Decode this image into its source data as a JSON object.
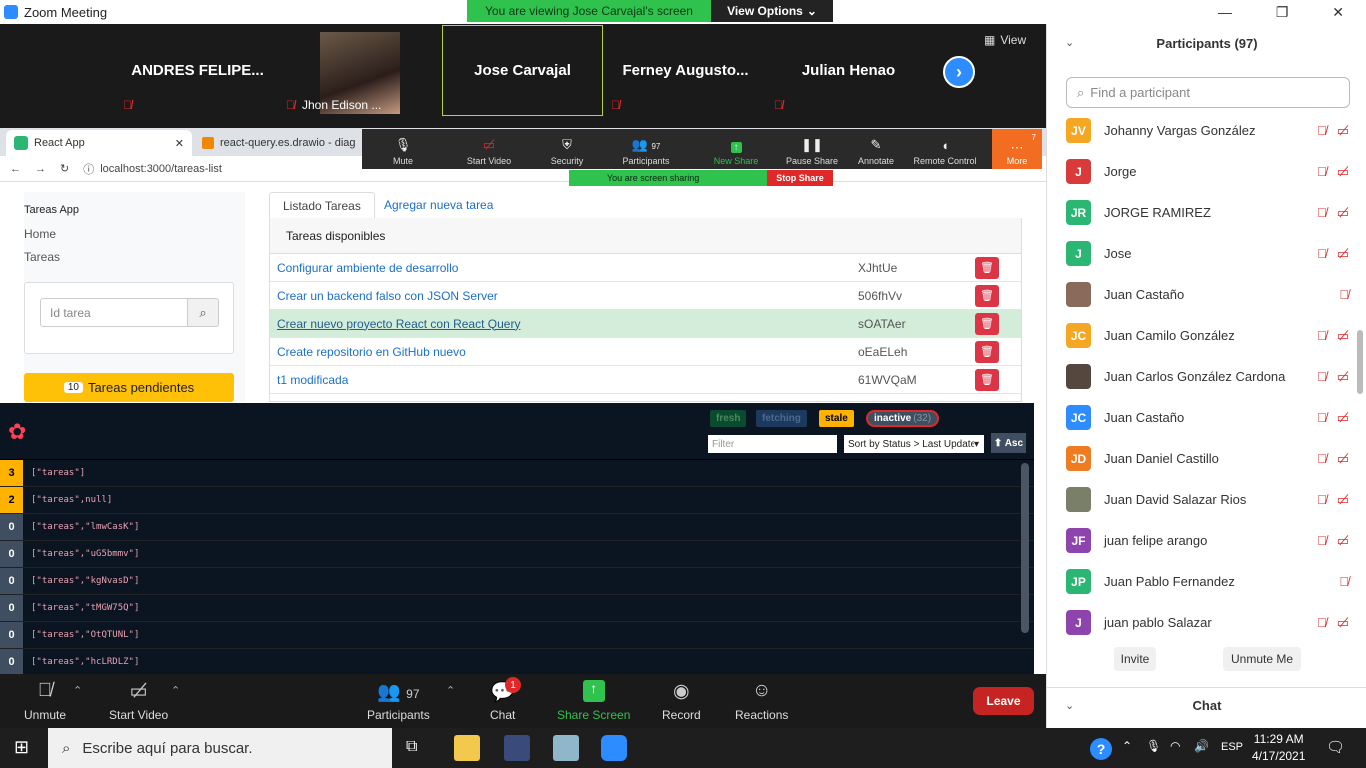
{
  "window": {
    "title": "Zoom Meeting"
  },
  "banner": {
    "viewing": "You are viewing Jose Carvajal's screen",
    "view_options": "View Options"
  },
  "strip": {
    "tiles": [
      {
        "name": "ANDRES  FELIPE..."
      },
      {
        "name": "Jhon Edison ..."
      },
      {
        "name": "Jose Carvajal"
      },
      {
        "name": "Ferney  Augusto..."
      },
      {
        "name": "Julian Henao"
      }
    ],
    "view_label": "View"
  },
  "browser": {
    "tab1": "React App",
    "tab2": "react-query.es.drawio - diagrama",
    "url": "localhost:3000/tareas-list"
  },
  "sharebar": {
    "mute": "Mute",
    "start_video": "Start Video",
    "security": "Security",
    "participants": "Participants",
    "participants_count": "97",
    "new_share": "New Share",
    "pause_share": "Pause Share",
    "annotate": "Annotate",
    "remote_control": "Remote Control",
    "more": "More",
    "more_badge": "7",
    "sharing": "You are screen sharing",
    "stop_share": "Stop Share"
  },
  "app": {
    "brand": "Tareas App",
    "nav_home": "Home",
    "nav_tareas": "Tareas",
    "id_placeholder": "Id tarea",
    "pending_count": "10",
    "pending_label": "Tareas pendientes",
    "tab_list": "Listado Tareas",
    "tab_add": "Agregar nueva tarea",
    "card_title": "Tareas disponibles",
    "tasks": [
      {
        "name": "Configurar ambiente de desarrollo",
        "id": "XJhtUe"
      },
      {
        "name": "Crear un backend falso con JSON Server",
        "id": "506fhVv"
      },
      {
        "name": "Crear nuevo proyecto React con React Query",
        "id": "sOATAer"
      },
      {
        "name": "Create repositorio en GitHub nuevo",
        "id": "oEaELeh"
      },
      {
        "name": "t1 modificada",
        "id": "61WVQaM"
      }
    ]
  },
  "devtools": {
    "fresh": "fresh",
    "fetching": "fetching",
    "stale": "stale",
    "inactive": "inactive",
    "inactive_count": "(32)",
    "filter_placeholder": "Filter",
    "sort": "Sort by Status > Last Update",
    "asc": "⬆ Asc",
    "queries": [
      {
        "count": "3",
        "key": "[\"tareas\"]"
      },
      {
        "count": "2",
        "key": "[\"tareas\",null]"
      },
      {
        "count": "0",
        "key": "[\"tareas\",\"lmwCasK\"]"
      },
      {
        "count": "0",
        "key": "[\"tareas\",\"uG5bmmv\"]"
      },
      {
        "count": "0",
        "key": "[\"tareas\",\"kgNvasD\"]"
      },
      {
        "count": "0",
        "key": "[\"tareas\",\"tMGW75Q\"]"
      },
      {
        "count": "0",
        "key": "[\"tareas\",\"OtQTUNL\"]"
      },
      {
        "count": "0",
        "key": "[\"tareas\",\"hcLRDLZ\"]"
      }
    ]
  },
  "bottombar": {
    "unmute": "Unmute",
    "start_video": "Start Video",
    "participants": "Participants",
    "participants_count": "97",
    "chat": "Chat",
    "chat_badge": "1",
    "share_screen": "Share Screen",
    "record": "Record",
    "reactions": "Reactions",
    "leave": "Leave"
  },
  "participants_panel": {
    "title": "Participants (97)",
    "search_placeholder": "Find a participant",
    "invite": "Invite",
    "unmute_me": "Unmute Me",
    "chat": "Chat",
    "list": [
      {
        "initials": "JV",
        "name": "Johanny Vargas González",
        "color": "#f5a623"
      },
      {
        "initials": "J",
        "name": "Jorge",
        "color": "#d93b3b"
      },
      {
        "initials": "JR",
        "name": "JORGE RAMIREZ",
        "color": "#2bb673"
      },
      {
        "initials": "J",
        "name": "Jose",
        "color": "#2bb673"
      },
      {
        "initials": "",
        "name": "Juan  Castaño",
        "color": "#8a6a5a"
      },
      {
        "initials": "JC",
        "name": "Juan Camilo González",
        "color": "#f5a623"
      },
      {
        "initials": "",
        "name": "Juan Carlos González Cardona",
        "color": "#55473d"
      },
      {
        "initials": "JC",
        "name": "Juan Castaño",
        "color": "#2d8cff"
      },
      {
        "initials": "JD",
        "name": "Juan Daniel Castillo",
        "color": "#f07c22"
      },
      {
        "initials": "",
        "name": "Juan David Salazar Rios",
        "color": "#7a7f6a"
      },
      {
        "initials": "JF",
        "name": "juan felipe arango",
        "color": "#8e44ad"
      },
      {
        "initials": "JP",
        "name": "Juan Pablo Fernandez",
        "color": "#2bb673"
      },
      {
        "initials": "J",
        "name": "juan pablo Salazar",
        "color": "#8e44ad"
      }
    ]
  },
  "taskbar": {
    "search_placeholder": "Escribe aquí para buscar.",
    "lang": "ESP",
    "time": "11:29 AM",
    "date": "4/17/2021"
  }
}
